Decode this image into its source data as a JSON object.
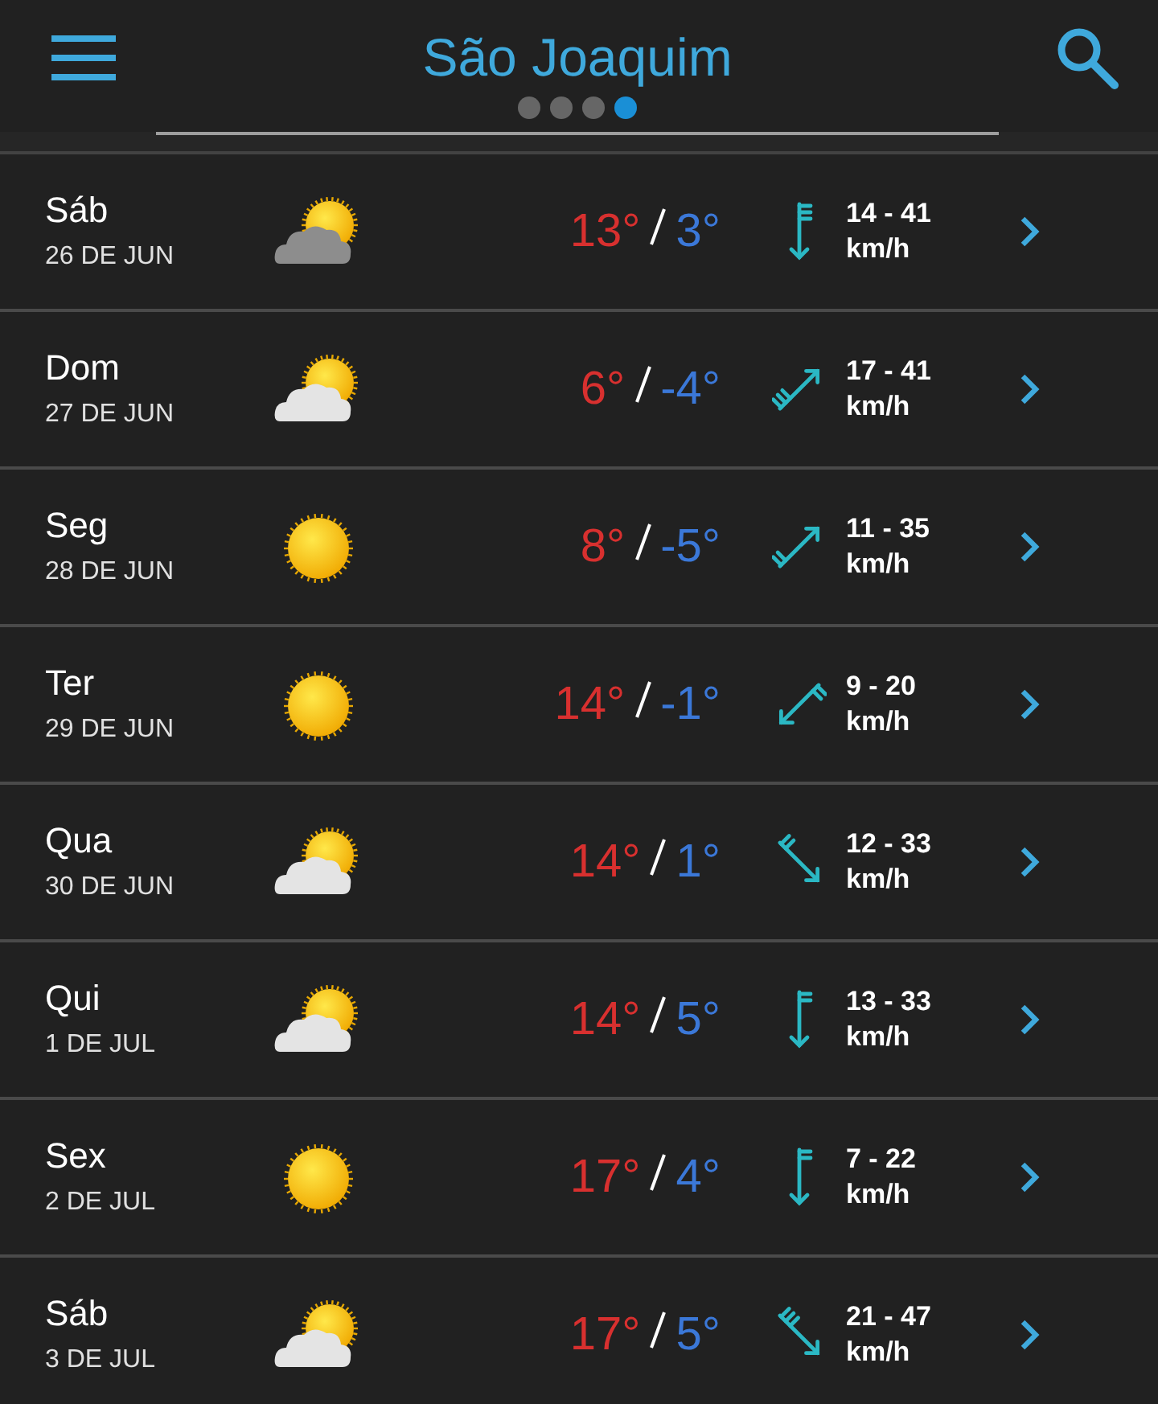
{
  "header": {
    "title": "São Joaquim",
    "pages": [
      {
        "selected": false
      },
      {
        "selected": false
      },
      {
        "selected": false
      },
      {
        "selected": true
      }
    ]
  },
  "days": [
    {
      "day": "Sáb",
      "date": "26 DE JUN",
      "weather_icon": {
        "kind": "cloudy"
      },
      "high": "13°",
      "low": "3°",
      "wind_icon": {
        "kind": "south",
        "strong": true
      },
      "wind": "14 - 41",
      "unit": "km/h"
    },
    {
      "day": "Dom",
      "date": "27 DE JUN",
      "weather_icon": {
        "kind": "partly"
      },
      "high": "6°",
      "low": "-4°",
      "wind_icon": {
        "kind": "northeast",
        "strong": true
      },
      "wind": "17 - 41",
      "unit": "km/h"
    },
    {
      "day": "Seg",
      "date": "28 DE JUN",
      "weather_icon": {
        "kind": "sunny"
      },
      "high": "8°",
      "low": "-5°",
      "wind_icon": {
        "kind": "northeast",
        "strong": false
      },
      "wind": "11 - 35",
      "unit": "km/h"
    },
    {
      "day": "Ter",
      "date": "29 DE JUN",
      "weather_icon": {
        "kind": "sunny"
      },
      "high": "14°",
      "low": "-1°",
      "wind_icon": {
        "kind": "southwest",
        "strong": false
      },
      "wind": "9 - 20",
      "unit": "km/h"
    },
    {
      "day": "Qua",
      "date": "30 DE JUN",
      "weather_icon": {
        "kind": "partly"
      },
      "high": "14°",
      "low": "1°",
      "wind_icon": {
        "kind": "southeast",
        "strong": false
      },
      "wind": "12 - 33",
      "unit": "km/h"
    },
    {
      "day": "Qui",
      "date": "1 DE JUL",
      "weather_icon": {
        "kind": "partly"
      },
      "high": "14°",
      "low": "5°",
      "wind_icon": {
        "kind": "south",
        "strong": false
      },
      "wind": "13 - 33",
      "unit": "km/h"
    },
    {
      "day": "Sex",
      "date": "2 DE JUL",
      "weather_icon": {
        "kind": "sunny"
      },
      "high": "17°",
      "low": "4°",
      "wind_icon": {
        "kind": "south",
        "strong": false
      },
      "wind": "7 - 22",
      "unit": "km/h"
    },
    {
      "day": "Sáb",
      "date": "3 DE JUL",
      "weather_icon": {
        "kind": "partly"
      },
      "high": "17°",
      "low": "5°",
      "wind_icon": {
        "kind": "southeast",
        "strong": true
      },
      "wind": "21 - 47",
      "unit": "km/h"
    }
  ]
}
